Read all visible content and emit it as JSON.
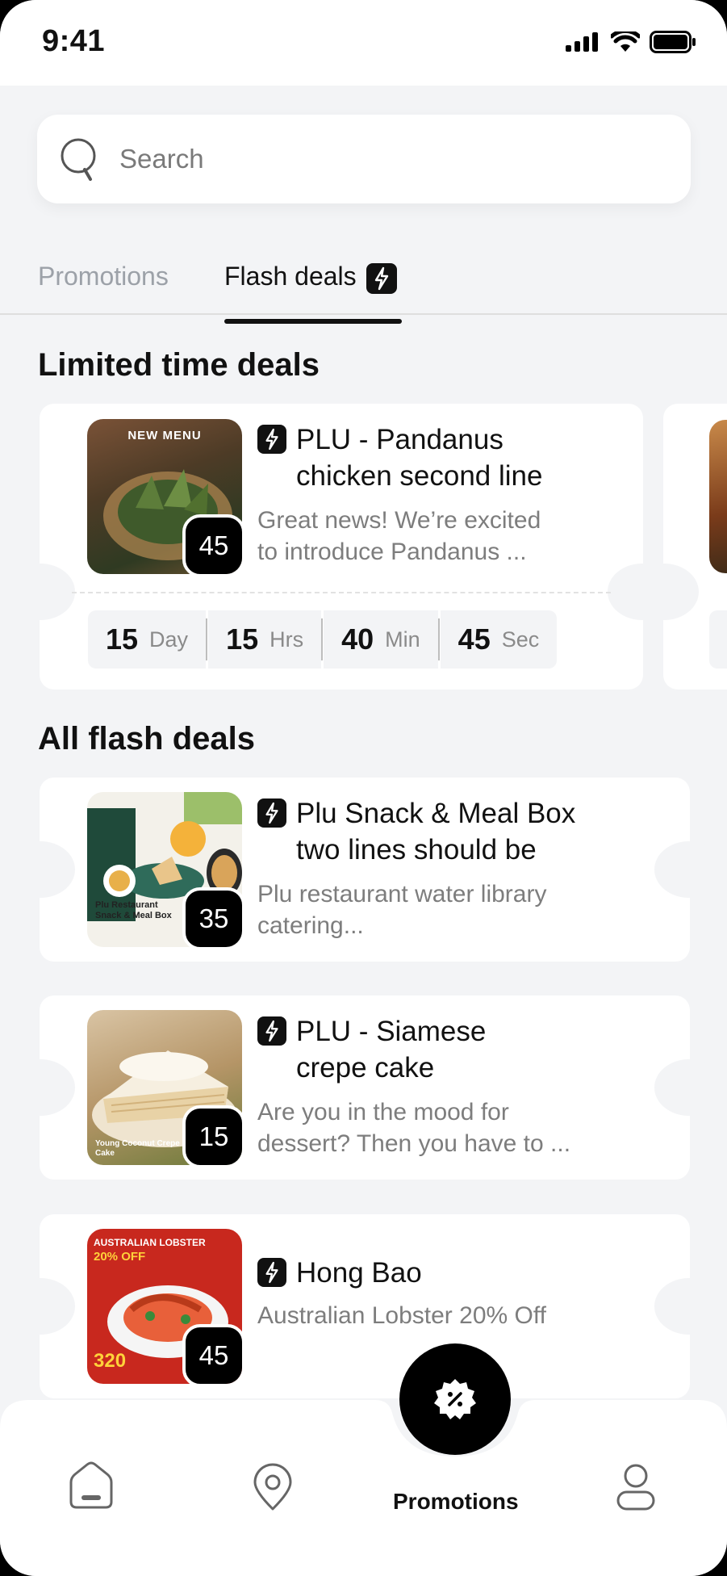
{
  "status_bar": {
    "time": "9:41"
  },
  "search": {
    "placeholder": "Search"
  },
  "tabs": [
    {
      "label": "Promotions",
      "active": false
    },
    {
      "label": "Flash deals",
      "active": true
    }
  ],
  "limited": {
    "title": "Limited time deals",
    "deal": {
      "title_line1": "PLU - Pandanus",
      "title_line2": "chicken second line",
      "desc_line1": "Great news! We’re excited",
      "desc_line2": "to introduce Pandanus ...",
      "count": "45",
      "image_text": "NEW MENU",
      "timer": [
        {
          "value": "15",
          "unit": "Day"
        },
        {
          "value": "15",
          "unit": "Hrs"
        },
        {
          "value": "40",
          "unit": "Min"
        },
        {
          "value": "45",
          "unit": "Sec"
        }
      ]
    }
  },
  "all": {
    "title": "All flash deals",
    "deals": [
      {
        "title_line1": "Plu Snack & Meal Box",
        "title_line2": "two lines should be",
        "desc_line1": "Plu restaurant water library",
        "desc_line2": "catering...",
        "count": "35",
        "image_text": "Plu Restaurant Snack & Meal Box"
      },
      {
        "title_line1": "PLU - Siamese",
        "title_line2": "crepe cake",
        "desc_line1": "Are you in the mood for",
        "desc_line2": "dessert? Then you have to ...",
        "count": "15",
        "image_text": "Young Coconut Crepe Cake"
      },
      {
        "title_line1": "Hong Bao",
        "title_line2": "",
        "desc_line1": "Australian Lobster 20% Off",
        "desc_line2": "",
        "count": "45",
        "image_text": "AUSTRALIAN LOBSTER",
        "image_text2": "20% OFF",
        "image_price": "320"
      }
    ]
  },
  "bottom_nav": {
    "items": [
      {
        "icon": "home-icon"
      },
      {
        "icon": "location-icon"
      },
      {
        "icon": "promotion-icon",
        "label": "Promotions",
        "active": true
      },
      {
        "icon": "profile-icon"
      }
    ]
  },
  "colors": {
    "background": "#f3f4f6",
    "card": "#ffffff",
    "accent": "#000000",
    "muted": "#7d7d7d"
  }
}
